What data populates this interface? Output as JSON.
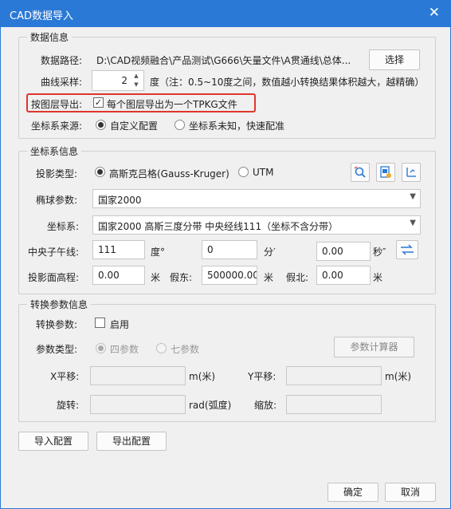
{
  "window": {
    "title": "CAD数据导入",
    "close_glyph": "✕"
  },
  "data_info": {
    "title": "数据信息",
    "path_label": "数据路径:",
    "path_value": "D:\\CAD视频融合\\产品测试\\G666\\矢量文件\\A贯通线\\总体...",
    "browse_label": "选择",
    "curve_label": "曲线采样:",
    "curve_value": "2",
    "curve_note": "度（注：0.5~10度之间，数值越小转换结果体积越大，越精确）",
    "layer_export_label": "按图层导出:",
    "layer_export_checked": true,
    "layer_export_option": "每个图层导出为一个TPKG文件",
    "source_label": "坐标系来源:",
    "source_options": [
      "自定义配置",
      "坐标系未知，快速配准"
    ],
    "source_selected": 0
  },
  "crs_info": {
    "title": "坐标系信息",
    "projection_label": "投影类型:",
    "projection_options": [
      "高斯克吕格(Gauss-Kruger)",
      "UTM"
    ],
    "projection_selected": 0,
    "ellipsoid_label": "椭球参数:",
    "ellipsoid_value": "国家2000",
    "crs_label": "坐标系:",
    "crs_value": "国家2000 高斯三度分带 中央经线111（坐标不含分带）",
    "meridian_label": "中央子午线:",
    "deg_value": "111",
    "deg_unit": "度°",
    "min_value": "0",
    "min_unit": "分′",
    "sec_value": "0.00",
    "sec_unit": "秒″",
    "elev_label": "投影面高程:",
    "elev_value": "0.00",
    "elev_unit": "米",
    "east_label": "假东:",
    "east_value": "500000.00",
    "east_unit": "米",
    "north_label": "假北:",
    "north_value": "0.00",
    "north_unit": "米"
  },
  "transform_info": {
    "title": "转换参数信息",
    "param_label": "转换参数:",
    "enable_label": "启用",
    "enable_checked": false,
    "type_label": "参数类型:",
    "type_options": [
      "四参数",
      "七参数"
    ],
    "type_selected": 0,
    "calc_label": "参数计算器",
    "x_label": "X平移:",
    "x_unit": "m(米)",
    "y_label": "Y平移:",
    "y_unit": "m(米)",
    "rot_label": "旋转:",
    "rot_unit": "rad(弧度)",
    "scale_label": "缩放:"
  },
  "footer": {
    "import_config": "导入配置",
    "export_config": "导出配置",
    "ok": "确定",
    "cancel": "取消"
  },
  "colors": {
    "titlebar": "#2b79d6",
    "highlight": "#e0352b",
    "accent_icon": "#2b79d6"
  }
}
